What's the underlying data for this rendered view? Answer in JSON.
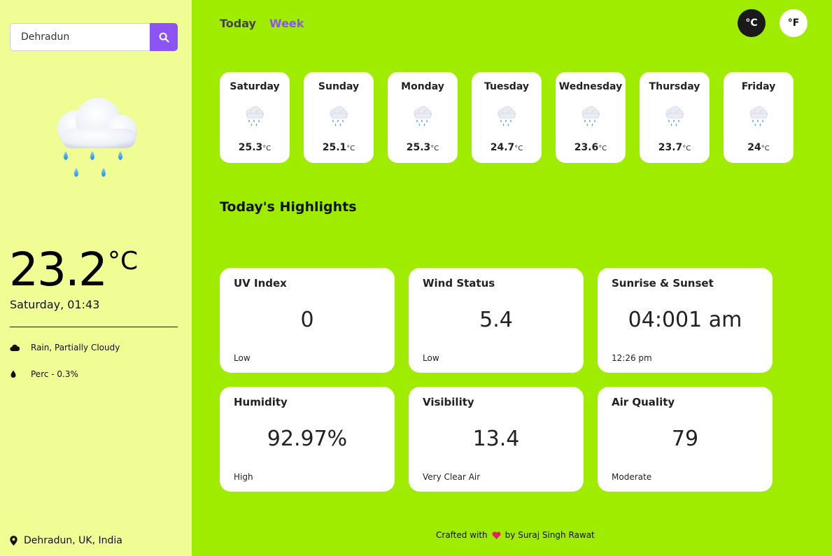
{
  "search": {
    "value": "Dehradun",
    "placeholder": "Search city..."
  },
  "current": {
    "temp": "23.2",
    "unit": "°C",
    "datetime": "Saturday, 01:43",
    "conditions": "Rain, Partially Cloudy",
    "precip": "Perc - 0.3%",
    "location": "Dehradun, UK, India"
  },
  "tabs": {
    "today": "Today",
    "week": "Week"
  },
  "units": {
    "c": "°C",
    "f": "°F"
  },
  "week": [
    {
      "day": "Saturday",
      "temp": "25.3",
      "unit": "°C"
    },
    {
      "day": "Sunday",
      "temp": "25.1",
      "unit": "°C"
    },
    {
      "day": "Monday",
      "temp": "25.3",
      "unit": "°C"
    },
    {
      "day": "Tuesday",
      "temp": "24.7",
      "unit": "°C"
    },
    {
      "day": "Wednesday",
      "temp": "23.6",
      "unit": "°C"
    },
    {
      "day": "Thursday",
      "temp": "23.7",
      "unit": "°C"
    },
    {
      "day": "Friday",
      "temp": "24",
      "unit": "°C"
    }
  ],
  "highlights": {
    "title": "Today's Highlights",
    "uv": {
      "title": "UV Index",
      "value": "0",
      "sub": "Low"
    },
    "wind": {
      "title": "Wind Status",
      "value": "5.4",
      "sub": "Low"
    },
    "sun": {
      "title": "Sunrise & Sunset",
      "value": "04:001 am",
      "sub": "12:26 pm"
    },
    "humidity": {
      "title": "Humidity",
      "value": "92.97%",
      "sub": "High"
    },
    "visibility": {
      "title": "Visibility",
      "value": "13.4",
      "sub": "Very Clear Air"
    },
    "air": {
      "title": "Air Quality",
      "value": "79",
      "sub": "Moderate"
    }
  },
  "footer": {
    "prefix": "Crafted with",
    "suffix": "by Suraj Singh Rawat"
  },
  "colors": {
    "accent": "#8d54f5",
    "main_bg": "#9fec00",
    "sidebar_bg": "#f0fc94"
  },
  "icons": {
    "search": "search-icon",
    "weather": "cloud-rain-icon",
    "cloud": "cloud-icon",
    "drop": "drop-icon",
    "pin": "map-pin-icon",
    "heart": "heart-icon"
  }
}
